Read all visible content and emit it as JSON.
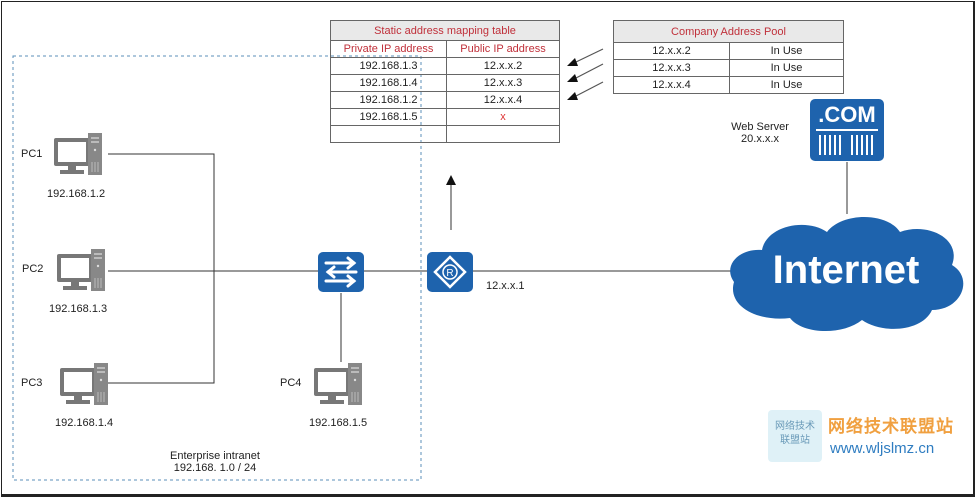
{
  "static_table": {
    "title": "Static address mapping table",
    "col_private": "Private IP address",
    "col_public": "Public IP address",
    "rows": [
      {
        "private": "192.168.1.3",
        "public": "12.x.x.2"
      },
      {
        "private": "192.168.1.4",
        "public": "12.x.x.3"
      },
      {
        "private": "192.168.1.2",
        "public": "12.x.x.4"
      },
      {
        "private": "192.168.1.5",
        "public": "x"
      },
      {
        "private": "",
        "public": ""
      }
    ]
  },
  "pool_table": {
    "title": "Company Address Pool",
    "rows": [
      {
        "address": "12.x.x.2",
        "status": "In Use"
      },
      {
        "address": "12.x.x.3",
        "status": "In Use"
      },
      {
        "address": "12.x.x.4",
        "status": "In Use"
      }
    ]
  },
  "web_server": {
    "label": "Web Server",
    "ip": "20.x.x.x",
    "icon_text": ".COM"
  },
  "internet": {
    "label": "Internet"
  },
  "router": {
    "ip": "12.x.x.1",
    "icon_text": "R"
  },
  "pcs": [
    {
      "name": "PC1",
      "ip": "192.168.1.2"
    },
    {
      "name": "PC2",
      "ip": "192.168.1.3"
    },
    {
      "name": "PC3",
      "ip": "192.168.1.4"
    },
    {
      "name": "PC4",
      "ip": "192.168.1.5"
    }
  ],
  "intranet": {
    "label": "Enterprise intranet",
    "subnet": "192.168. 1.0 / 24"
  },
  "watermark": {
    "box_line1": "网络技术",
    "box_line2": "联盟站",
    "name": "网络技术联盟站",
    "url": "www.wljslmz.cn"
  },
  "colors": {
    "device_blue": "#1e63ad",
    "table_red": "#c0303a",
    "pc_gray": "#777777"
  }
}
